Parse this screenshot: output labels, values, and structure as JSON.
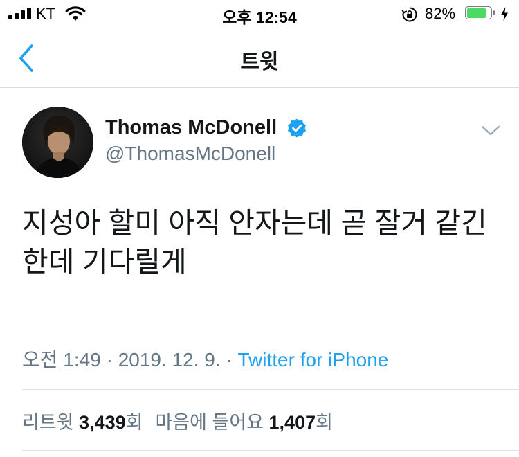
{
  "status_bar": {
    "carrier": "KT",
    "time": "오후 12:54",
    "battery_percent": "82%",
    "battery_level": 0.82,
    "battery_color": "#4cd964"
  },
  "nav": {
    "title": "트윗",
    "back_icon": "chevron-left-icon"
  },
  "tweet": {
    "display_name": "Thomas McDonell",
    "handle": "@ThomasMcDonell",
    "verified": true,
    "text_line1": "지성아 할미 아직 안자는데 곧 잘거 같긴",
    "text_line2": "한데 기다릴게",
    "time": "오전 1:49",
    "date": "2019. 12. 9.",
    "separator": " · ",
    "source": "Twitter for iPhone"
  },
  "stats": {
    "retweet_label": "리트윗",
    "retweet_count": "3,439",
    "retweet_suffix": "회",
    "like_label": "마음에 들어요",
    "like_count": "1,407",
    "like_suffix": "회"
  },
  "colors": {
    "accent": "#1da1f2",
    "secondary_text": "#657786",
    "primary_text": "#14171a"
  }
}
